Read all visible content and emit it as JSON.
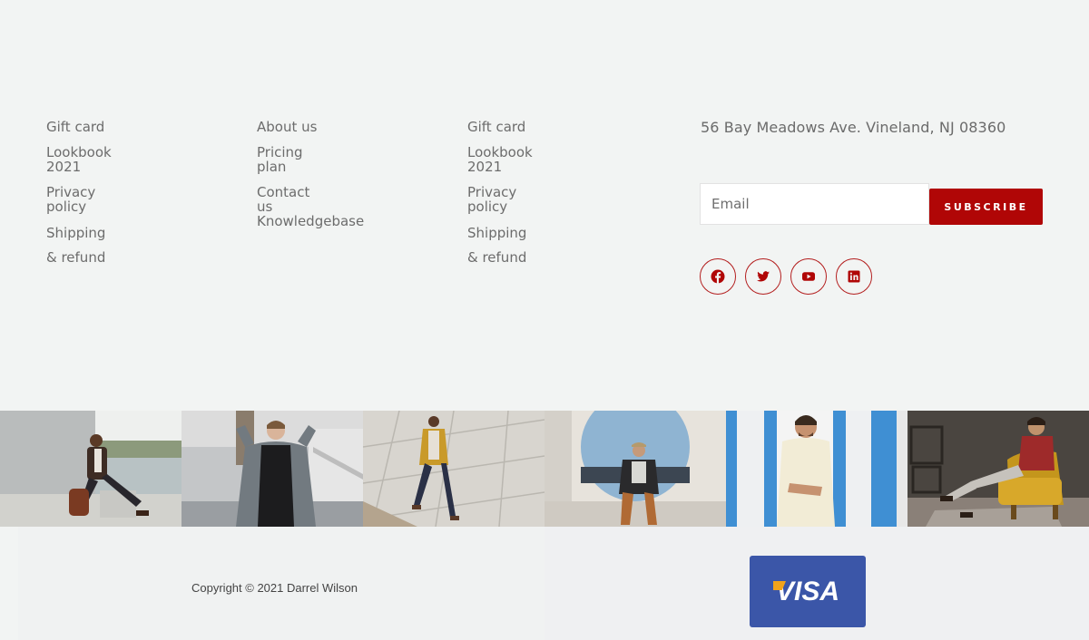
{
  "footer": {
    "columns": [
      {
        "links": [
          "Gift card",
          "Lookbook 2021",
          "Privacy policy",
          "Shipping & refund"
        ]
      },
      {
        "links": [
          "About us",
          "Pricing plan",
          "Contact us",
          "Knowledgebase"
        ]
      },
      {
        "links": [
          "Gift card",
          "Lookbook 2021",
          "Privacy policy",
          "Shipping & refund"
        ]
      }
    ],
    "address": "56 Bay Meadows Ave. Vineland, NJ 08360",
    "newsletter": {
      "placeholder": "Email",
      "button_label": "SUBSCRIBE"
    },
    "socials": [
      {
        "icon": "facebook-icon"
      },
      {
        "icon": "twitter-icon"
      },
      {
        "icon": "youtube-icon"
      },
      {
        "icon": "linkedin-icon"
      }
    ]
  },
  "gallery": {
    "photos": [
      {
        "icon": "photo-man-with-bag"
      },
      {
        "icon": "photo-man-gray-jacket"
      },
      {
        "icon": "photo-man-yellow-jacket"
      },
      {
        "icon": "photo-man-sitting-window"
      },
      {
        "icon": "photo-man-smiling-door"
      },
      {
        "icon": "photo-man-armchair"
      }
    ]
  },
  "bottom": {
    "copyright": "Copyright © 2021 Darrel Wilson",
    "payment": "VISA"
  },
  "colors": {
    "accent": "#b00606",
    "social_border": "#b31d1d",
    "visa_blue": "#3b56a8",
    "background": "#f2f4f3"
  }
}
